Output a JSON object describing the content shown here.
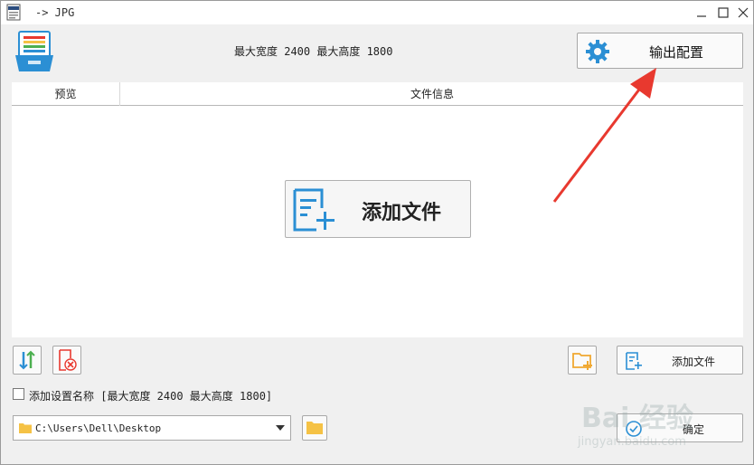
{
  "window": {
    "title": "-> JPG"
  },
  "header": {
    "size_info": "最大宽度 2400  最大高度 1800",
    "output_button_label": "输出配置"
  },
  "list": {
    "columns": [
      "预览",
      "文件信息"
    ],
    "add_button_label": "添加文件"
  },
  "toolbar": {
    "add_file_label": "添加文件",
    "add_setting_name_label": "添加设置名称 [最大宽度 2400 最大高度 1800]",
    "output_path": "C:\\Users\\Dell\\Desktop",
    "ok_label": "确定"
  },
  "watermark": {
    "line1": "Bai 经验",
    "line2": "jingyan.baidu.com"
  },
  "colors": {
    "accent_blue": "#2b8fd4",
    "arrow_red": "#e8392f",
    "folder_yellow": "#f5c245"
  }
}
